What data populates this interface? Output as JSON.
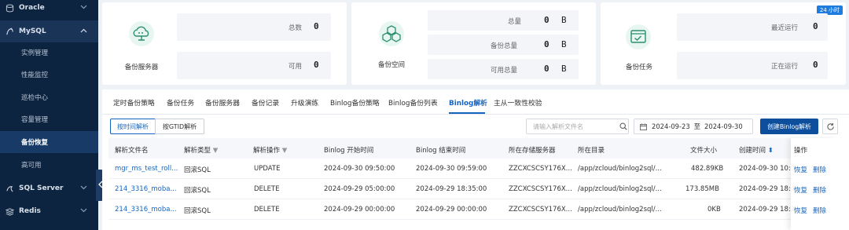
{
  "sidebar": {
    "oracle": "Oracle",
    "mysql": "MySQL",
    "mysql_items": [
      "实例管理",
      "性能监控",
      "巡检中心",
      "容量管理",
      "备份恢复",
      "高可用"
    ],
    "sqlserver": "SQL Server",
    "redis": "Redis"
  },
  "cards": {
    "server": {
      "caption": "备份服务器",
      "total_label": "总数",
      "total_value": "0",
      "avail_label": "可用",
      "avail_value": "0"
    },
    "space": {
      "caption": "备份空间",
      "total_label": "总量",
      "total_value": "0",
      "total_unit": "B",
      "backup_label": "备份总量",
      "backup_value": "0",
      "backup_unit": "B",
      "avail_label": "可用总量",
      "avail_value": "0",
      "avail_unit": "B"
    },
    "task": {
      "caption": "备份任务",
      "badge": "24 小时",
      "recent_label": "最近运行",
      "recent_value": "0",
      "running_label": "正在运行",
      "running_value": "0"
    }
  },
  "tabs": [
    "定时备份策略",
    "备份任务",
    "备份服务器",
    "备份记录",
    "升级演练",
    "Binlog备份策略",
    "Binlog备份列表",
    "Binlog解析",
    "主从一致性校验"
  ],
  "active_tab": "Binlog解析",
  "toolbar": {
    "seg_time": "按时间解析",
    "seg_gtid": "按GTID解析",
    "search_placeholder": "请输入解析文件名",
    "date_start": "2024-09-23",
    "date_sep": "至",
    "date_end": "2024-09-30",
    "create_button": "创建Binlog解析"
  },
  "table": {
    "headers": [
      "解析文件名",
      "解析类型",
      "解析操作",
      "Binlog 开始时间",
      "Binlog 结束时间",
      "所在存储服务器",
      "所在目录",
      "文件大小",
      "创建时间",
      "操作"
    ],
    "rows": [
      {
        "name": "mgr_ms_test_roll...",
        "type": "回滚SQL",
        "op": "UPDATE",
        "start": "2024-09-30 09:50:00",
        "end": "2024-09-30 09:59:00",
        "server": "ZZCXCSCSY176X...",
        "dir": "/app/zcloud/binlog2sql/...",
        "size": "482.89KB",
        "created": "2024-09-30 10:0",
        "restore": "恢复",
        "delete": "删除"
      },
      {
        "name": "214_3316_moba...",
        "type": "回滚SQL",
        "op": "DELETE",
        "start": "2024-09-29 05:00:00",
        "end": "2024-09-29 18:35:00",
        "server": "ZZCXCSCSY176X...",
        "dir": "/app/zcloud/binlog2sql/...",
        "size": "173.85MB",
        "created": "2024-09-29 18:4",
        "restore": "恢复",
        "delete": "删除"
      },
      {
        "name": "214_3316_moba...",
        "type": "回滚SQL",
        "op": "DELETE",
        "start": "2024-09-29 00:00:00",
        "end": "2024-09-29 00:00:00",
        "server": "ZZCXCSCSY176X...",
        "dir": "/app/zcloud/binlog2sql/...",
        "size": "0KB",
        "created": "2024-09-29 18:2",
        "restore": "恢复",
        "delete": "删除"
      }
    ]
  },
  "colors": {
    "sidebar_bg": "#0d2440",
    "accent": "#1565c0",
    "primary_button": "#0d4f9c",
    "badge": "#1e7be0"
  }
}
